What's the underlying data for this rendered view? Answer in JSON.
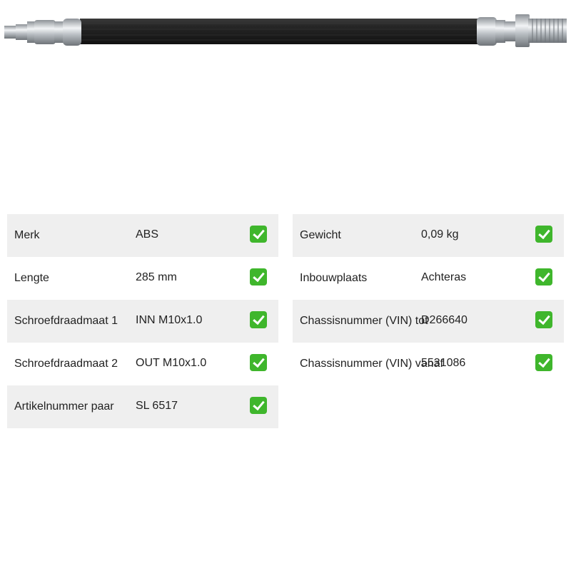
{
  "product_image": {
    "icon": "brake-hose-icon"
  },
  "specs_left": [
    {
      "label": "Merk",
      "value": "ABS",
      "status_icon": "check-icon"
    },
    {
      "label": "Lengte",
      "value": "285 mm",
      "status_icon": "check-icon"
    },
    {
      "label": "Schroefdraadmaat 1",
      "value": "INN M10x1.0",
      "status_icon": "check-icon"
    },
    {
      "label": "Schroefdraadmaat 2",
      "value": "OUT M10x1.0",
      "status_icon": "check-icon"
    },
    {
      "label": "Artikelnummer paar",
      "value": "SL 6517",
      "status_icon": "check-icon"
    }
  ],
  "specs_right": [
    {
      "label": "Gewicht",
      "value": "0,09 kg",
      "status_icon": "check-icon"
    },
    {
      "label": "Inbouwplaats",
      "value": "Achteras",
      "status_icon": "check-icon"
    },
    {
      "label": "Chassisnummer (VIN) tot",
      "value": "D266640",
      "status_icon": "check-icon"
    },
    {
      "label": "Chassisnummer (VIN) vanaf",
      "value": "5531086",
      "status_icon": "check-icon"
    }
  ],
  "colors": {
    "row_shade": "#efefef",
    "check_green": "#3fb62c",
    "hose_black": "#1f1f1f"
  }
}
